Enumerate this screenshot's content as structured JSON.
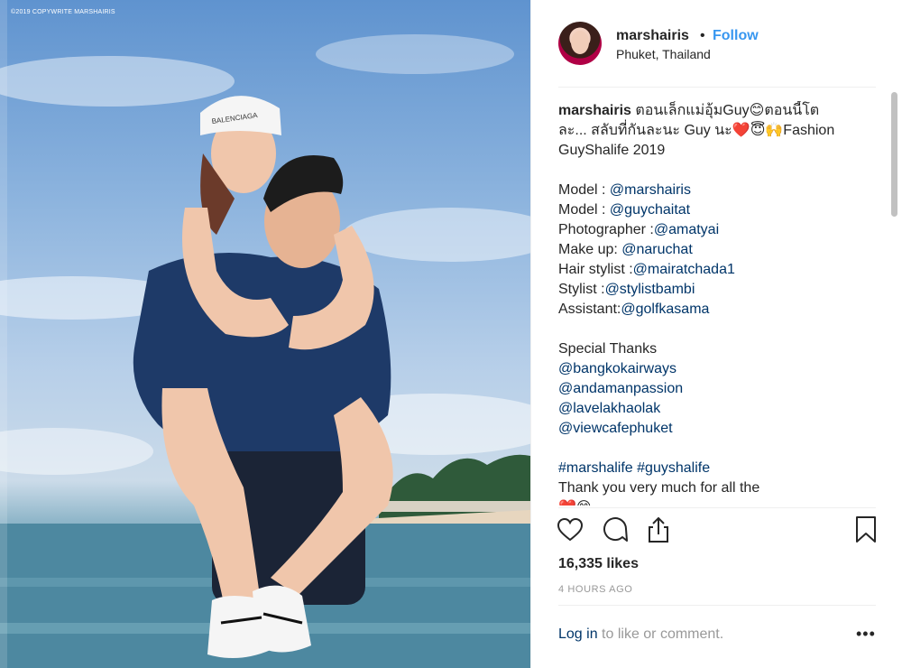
{
  "photo": {
    "copyright": "©2019 COPYWRITE MARSHAIRIS",
    "cap_text": "BALENCIAGA"
  },
  "header": {
    "username": "marshairis",
    "separator": "•",
    "follow_label": "Follow",
    "location": "Phuket, Thailand"
  },
  "caption": {
    "username": "marshairis",
    "lines": [
      "ตอนเล็กแม่อุ้มGuy😊ตอนนี้โต",
      "ละ... สลับที่กันละนะ Guy นะ❤️😇🙌Fashion",
      "GuyShalife 2019"
    ],
    "credits": [
      {
        "label": "Model : ",
        "handle": "@marshairis"
      },
      {
        "label": "Model : ",
        "handle": "@guychaitat"
      },
      {
        "label": "Photographer :",
        "handle": "@amatyai"
      },
      {
        "label": "Make up: ",
        "handle": "@naruchat"
      },
      {
        "label": "Hair stylist :",
        "handle": "@mairatchada1"
      },
      {
        "label": "Stylist :",
        "handle": "@stylistbambi"
      },
      {
        "label": "Assistant:",
        "handle": "@golfkasama"
      }
    ],
    "thanks_title": "Special Thanks",
    "thanks": [
      "@bangkokairways",
      "@andamanpassion",
      "@lavelakhaolak",
      "@viewcafephuket"
    ],
    "hashtags": "#marshalife #guyshalife",
    "closing": "Thank you very much for all the",
    "closing_emoji": "❤️😊"
  },
  "actions": {
    "like_icon": "heart-outline-icon",
    "comment_icon": "comment-bubble-icon",
    "share_icon": "share-upload-icon",
    "save_icon": "bookmark-icon"
  },
  "likes": "16,335 likes",
  "timestamp": "4 HOURS AGO",
  "login": {
    "link_text": "Log in",
    "rest_text": " to like or comment."
  },
  "more_label": "•••",
  "colors": {
    "follow_blue": "#3897f0",
    "link_blue": "#003569",
    "muted": "#999999",
    "text": "#262626"
  }
}
